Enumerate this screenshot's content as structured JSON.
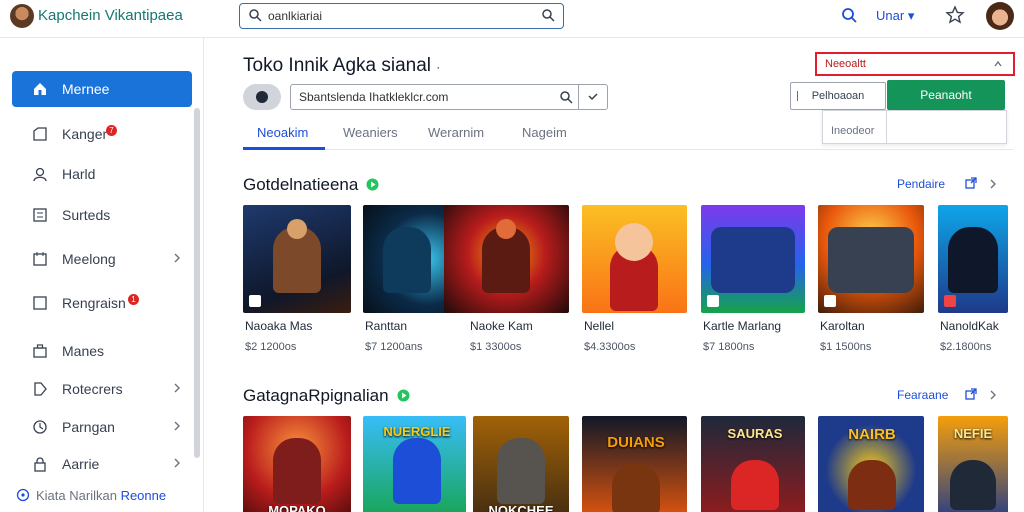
{
  "header": {
    "app_title": "Kapchein Vikantipaea",
    "search_value": "oanlkiariai",
    "language": "Unar"
  },
  "sidebar": {
    "items": [
      {
        "label": "Mernee",
        "icon": "home-icon",
        "badge": "",
        "chevron": false
      },
      {
        "label": "Kanger",
        "icon": "folder-icon",
        "badge": "7",
        "chevron": false
      },
      {
        "label": "Harld",
        "icon": "user-icon",
        "badge": "",
        "chevron": false
      },
      {
        "label": "Surteds",
        "icon": "list-icon",
        "badge": "",
        "chevron": false
      },
      {
        "label": "Meelong",
        "icon": "calendar-icon",
        "badge": "",
        "chevron": true
      },
      {
        "label": "Rengraisn",
        "icon": "square-icon",
        "badge": "1",
        "chevron": false
      },
      {
        "label": "Manes",
        "icon": "briefcase-icon",
        "badge": "",
        "chevron": false
      },
      {
        "label": "Rotecrers",
        "icon": "tag-icon",
        "badge": "",
        "chevron": true
      },
      {
        "label": "Parngan",
        "icon": "clock-icon",
        "badge": "",
        "chevron": true
      },
      {
        "label": "Aarrie",
        "icon": "lock-icon",
        "badge": "",
        "chevron": true
      }
    ],
    "footer_text": "Kiata Narilkan",
    "footer_link": "Reonne"
  },
  "main": {
    "title": "Toko Innik Agka sianal",
    "url_value": "Sbantslenda Ihatkleklcr.com",
    "tabs": [
      "Neoakim",
      "Weaniers",
      "Werarnim",
      "Nageim"
    ],
    "select_value": "Neeoaltt",
    "button_outline": "Pelhoaoan",
    "button_primary": "Peanaoht",
    "dropdown_option": "Ineodeor"
  },
  "sections": [
    {
      "title": "Gotdelnatieena",
      "link": "Pendaire",
      "cards": [
        {
          "name": "Naoaka Mas",
          "sub": "$2 1200os",
          "caption": ""
        },
        {
          "name": "Ranttan",
          "sub": "$7 1200ans",
          "caption": ""
        },
        {
          "name": "Naoke Kam",
          "sub": "$1 3300os",
          "caption": ""
        },
        {
          "name": "Nellel",
          "sub": "$4.3300os",
          "caption": ""
        },
        {
          "name": "Kartle Marlang",
          "sub": "$7 1800ns",
          "caption": ""
        },
        {
          "name": "Karoltan",
          "sub": "$1 1500ns",
          "caption": ""
        },
        {
          "name": "NanoldKak",
          "sub": "$2.1800ns",
          "caption": ""
        }
      ]
    },
    {
      "title": "GatagnaRpignalian",
      "link": "Fearaane",
      "cards": [
        {
          "name": "",
          "sub": "",
          "caption": "MOPAKO"
        },
        {
          "name": "",
          "sub": "",
          "caption": "NUERGLIE"
        },
        {
          "name": "",
          "sub": "",
          "caption": "NOKCHEE"
        },
        {
          "name": "",
          "sub": "",
          "caption": "DUIANS"
        },
        {
          "name": "",
          "sub": "",
          "caption": "SAURAS"
        },
        {
          "name": "",
          "sub": "",
          "caption": "NAIRB"
        },
        {
          "name": "",
          "sub": "",
          "caption": "NEFIE"
        }
      ]
    }
  ],
  "colors": {
    "accent": "#1a73d9",
    "primary_button": "#15945a",
    "select_border": "#e11d2f",
    "badge": "#dc2626"
  }
}
